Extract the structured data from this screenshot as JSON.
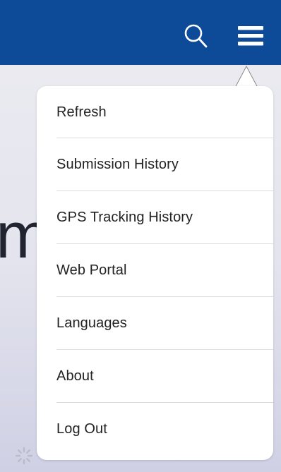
{
  "header": {
    "search_icon": "search-icon",
    "menu_icon": "hamburger-menu-icon",
    "color": "#0d4a98"
  },
  "background": {
    "partial_text": "m"
  },
  "menu": {
    "items": [
      {
        "label": "Refresh"
      },
      {
        "label": "Submission History"
      },
      {
        "label": "GPS Tracking History"
      },
      {
        "label": "Web Portal"
      },
      {
        "label": "Languages"
      },
      {
        "label": "About"
      },
      {
        "label": "Log Out"
      }
    ]
  }
}
